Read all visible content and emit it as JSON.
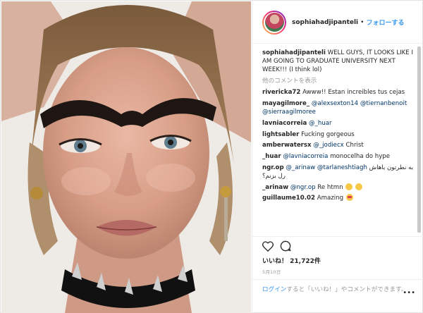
{
  "post": {
    "username": "sophiahadjipanteli",
    "follow_label": "フォローする",
    "separator": "•"
  },
  "caption": {
    "username": "sophiahadjipanteli",
    "text": "WELL GUYS, IT LOOKS LIKE I AM GOING TO GRADUATE UNIVERSITY NEXT WEEK!!! (I think lol)"
  },
  "more_comments_label": "他のコメントを表示",
  "comments": [
    {
      "user": "rivericka72",
      "text": "Awww!! Estan increibles tus cejas"
    },
    {
      "user": "mayagilmore_",
      "mentions": [
        "@alexsexton14",
        "@tiernanbenoit",
        "@sierraagilmoree"
      ]
    },
    {
      "user": "lavniacorreia",
      "mentions": [
        "@_huar"
      ]
    },
    {
      "user": "lightsabler",
      "text": "Fucking gorgeous"
    },
    {
      "user": "amberwatersx",
      "mentions": [
        "@_jodiecx"
      ],
      "text": "Christ"
    },
    {
      "user": "_huar",
      "mentions": [
        "@lavniacorreia"
      ],
      "text": "monocelha do hype"
    },
    {
      "user": "ngr.op",
      "mentions": [
        "@_arinaw",
        "@tarlaneshtiagh"
      ],
      "text": "به نطرتون باهاش رل بزنم؟"
    },
    {
      "user": "_arinaw",
      "mentions": [
        "@ngr.op"
      ],
      "text": "Re htmn"
    },
    {
      "user": "guillaume10.02",
      "text": "Amazing"
    }
  ],
  "likes": {
    "label": "いいね！",
    "count": "21,722件"
  },
  "date": "5月10日",
  "login": {
    "link": "ログイン",
    "text": "すると「いいね！」やコメントができます。"
  },
  "more_icon": "more-horizontal-icon",
  "colors": {
    "link": "#3897f0",
    "mention": "#003569",
    "muted": "#999999",
    "text": "#262626"
  }
}
